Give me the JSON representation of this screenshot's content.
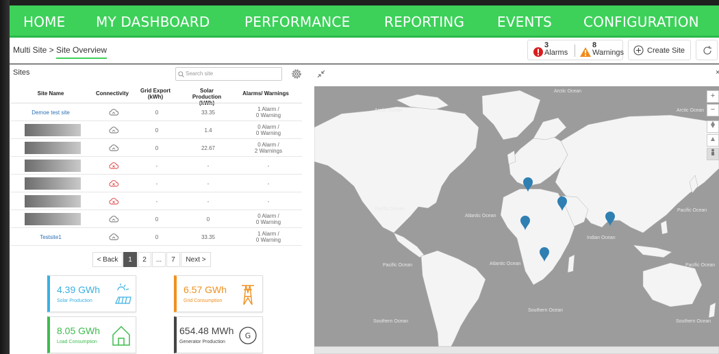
{
  "nav": {
    "items": [
      "HOME",
      "MY DASHBOARD",
      "PERFORMANCE",
      "REPORTING",
      "EVENTS",
      "CONFIGURATION"
    ]
  },
  "breadcrumb": {
    "root": "Multi Site >",
    "current": "Site Overview"
  },
  "header": {
    "alarms_count": "3",
    "alarms_label": "Alarms",
    "warnings_count": "8",
    "warnings_label": "Warnings",
    "create_site_label": "Create Site"
  },
  "sites": {
    "title": "Sites",
    "search_placeholder": "Search site",
    "columns": [
      "Site Name",
      "Connectivity",
      "Grid Export (kWh)",
      "Solar Production (kWh)",
      "Alarms/ Warnings"
    ],
    "rows": [
      {
        "name": "Demoe test site",
        "status": "online",
        "grid": "0",
        "solar": "33.35",
        "alerts1": "1 Alarm /",
        "alerts2": "0 Warning"
      },
      {
        "name": "",
        "status": "online",
        "grid": "0",
        "solar": "1.4",
        "alerts1": "0 Alarm /",
        "alerts2": "0 Warning"
      },
      {
        "name": "",
        "status": "online",
        "grid": "0",
        "solar": "22.67",
        "alerts1": "0 Alarm /",
        "alerts2": "2 Warnings"
      },
      {
        "name": "",
        "status": "offline",
        "grid": "-",
        "solar": "-",
        "alerts1": "-",
        "alerts2": ""
      },
      {
        "name": "",
        "status": "offline",
        "grid": "-",
        "solar": "-",
        "alerts1": "-",
        "alerts2": ""
      },
      {
        "name": "",
        "status": "offline",
        "grid": "-",
        "solar": "-",
        "alerts1": "-",
        "alerts2": ""
      },
      {
        "name": "",
        "status": "online",
        "grid": "0",
        "solar": "0",
        "alerts1": "0 Alarm /",
        "alerts2": "0 Warning"
      },
      {
        "name": "Testsite1",
        "status": "online",
        "grid": "0",
        "solar": "33.35",
        "alerts1": "1 Alarm /",
        "alerts2": "0 Warning"
      }
    ]
  },
  "pagination": {
    "back": "< Back",
    "pages": [
      "1",
      "2",
      "...",
      "7"
    ],
    "next": "Next >",
    "current": "1"
  },
  "cards": [
    {
      "value": "4.39 GWh",
      "label": "Solar Production",
      "color": "#3ab0e2",
      "icon": "solar-panel-icon"
    },
    {
      "value": "6.57 GWh",
      "label": "Grid Consumption",
      "color": "#f0901e",
      "icon": "power-tower-icon"
    },
    {
      "value": "8.05 GWh",
      "label": "Load Consumption",
      "color": "#3dbb4e",
      "icon": "house-icon"
    },
    {
      "value": "654.48 MWh",
      "label": "Generator Production",
      "color": "#444444",
      "icon": "generator-icon"
    }
  ],
  "map": {
    "oceans": [
      "Arctic Ocean",
      "Arctic Ocean",
      "Arctic Ocean",
      "Pacific Ocean",
      "Atlantic Ocean",
      "Pacific Ocean",
      "Indian Ocean",
      "Pacific Ocean",
      "Atlantic Ocean",
      "Pacific Ocean",
      "Southern Ocean",
      "Southern Ocean",
      "Southern Ocean"
    ],
    "zoom_in": "+",
    "zoom_out": "−"
  },
  "colors": {
    "nav_green": "#3dd15a",
    "link_blue": "#2d6fb4",
    "marker_blue": "#2f7fb3",
    "alarm_red": "#d81e1e",
    "warning_orange": "#f08a1c"
  }
}
